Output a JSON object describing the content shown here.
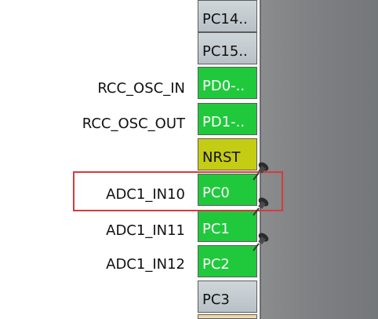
{
  "pins": [
    {
      "label": "PC14..",
      "color": "gray"
    },
    {
      "label": "PC15..",
      "color": "gray"
    },
    {
      "label": "PD0-..",
      "color": "green",
      "signal": "RCC_OSC_IN"
    },
    {
      "label": "PD1-..",
      "color": "green",
      "signal": "RCC_OSC_OUT"
    },
    {
      "label": "NRST",
      "color": "yellow"
    },
    {
      "label": "PC0",
      "color": "green",
      "signal": "ADC1_IN10",
      "pinned": true,
      "highlighted": true
    },
    {
      "label": "PC1",
      "color": "green",
      "signal": "ADC1_IN11",
      "pinned": true
    },
    {
      "label": "PC2",
      "color": "green",
      "signal": "ADC1_IN12",
      "pinned": true
    },
    {
      "label": "PC3",
      "color": "gray"
    }
  ],
  "colors": {
    "pin_green": "#20c93c",
    "pin_yellow": "#c5cc14",
    "pin_gray": "#c2cacf",
    "highlight_red": "#d63b3b",
    "chip_body": "#7f8183"
  },
  "icons": {
    "pinned": "pushpin-icon"
  }
}
